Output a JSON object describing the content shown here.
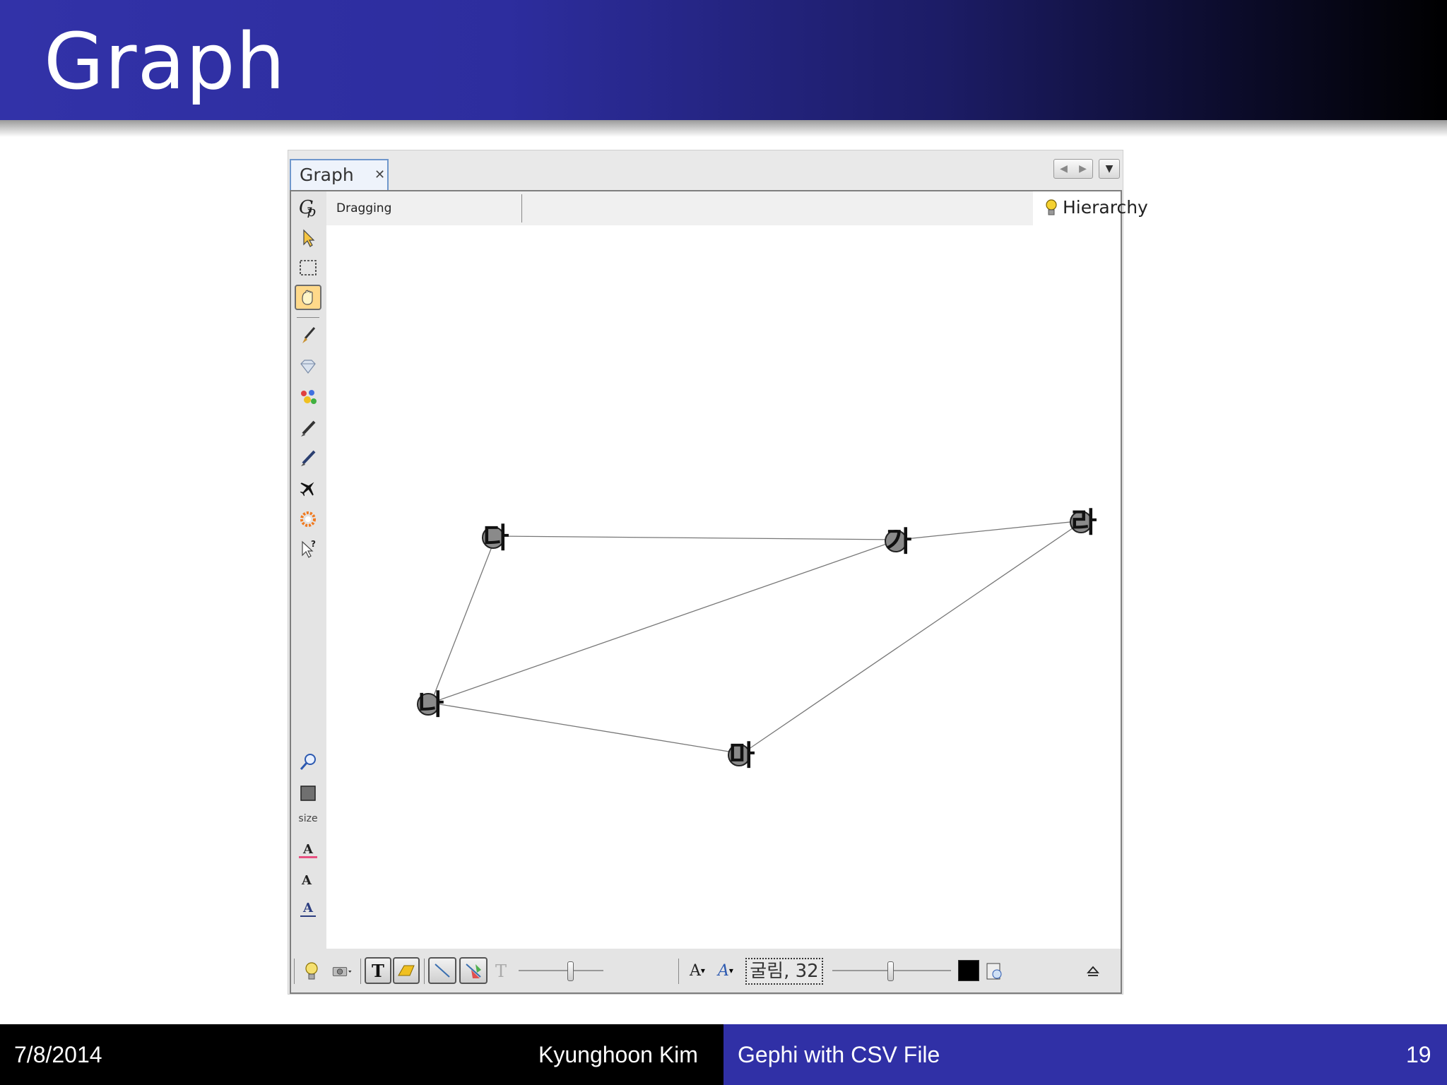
{
  "slide": {
    "title": "Graph",
    "footer": {
      "date": "7/8/2014",
      "author": "Kyunghoon Kim",
      "topic": "Gephi with CSV File",
      "page": "19"
    }
  },
  "window": {
    "tab_label": "Graph",
    "tab_close_glyph": "✕",
    "status": "Dragging",
    "hierarchy_label": "Hierarchy",
    "left_toolbar": [
      "gephi-logo-icon",
      "select-arrow-icon",
      "rectangle-select-icon",
      "drag-hand-icon",
      "brush-icon",
      "diamond-icon",
      "paint-bucket-icon",
      "pencil-icon",
      "edge-pencil-icon",
      "airplane-icon",
      "sun-gear-icon",
      "help-cursor-icon",
      "zoom-fit-icon",
      "node-color-icon",
      "label-color-icon",
      "label-size-icon",
      "label-font-icon"
    ],
    "size_label": "size",
    "bottom_toolbar": {
      "font_box": "굴림, 32",
      "label_color": "#000000",
      "font_size_glyph": "A",
      "font_style_glyph": "A"
    }
  },
  "graph": {
    "nodes": [
      {
        "id": "da",
        "label": "다"
      },
      {
        "id": "ga",
        "label": "가"
      },
      {
        "id": "ra",
        "label": "라"
      },
      {
        "id": "na",
        "label": "나"
      },
      {
        "id": "ma",
        "label": "마"
      }
    ],
    "edges": [
      [
        "da",
        "ga"
      ],
      [
        "ga",
        "ra"
      ],
      [
        "da",
        "na"
      ],
      [
        "na",
        "ga"
      ],
      [
        "na",
        "ma"
      ],
      [
        "ma",
        "ra"
      ]
    ],
    "edge_color": "#777777",
    "node_color": "#8a8a8a"
  }
}
